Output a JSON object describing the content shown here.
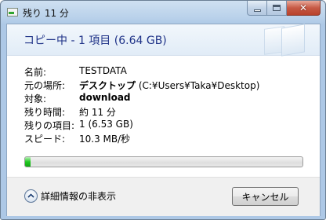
{
  "window": {
    "title": "残り 11 分"
  },
  "header": {
    "title": "コピー中 - 1 項目 (6.64 GB)"
  },
  "details": [
    {
      "label": "名前:",
      "value_bold": "",
      "value": "TESTDATA"
    },
    {
      "label": "元の場所:",
      "value_bold": "デスクトップ",
      "value": " (C:¥Users¥Taka¥Desktop)"
    },
    {
      "label": "対象:",
      "value_bold": "download",
      "value": ""
    },
    {
      "label": "残り時間:",
      "value_bold": "",
      "value": "約 11 分"
    },
    {
      "label": "残りの項目:",
      "value_bold": "",
      "value": "1 (6.53 GB)"
    },
    {
      "label": "スピード:",
      "value_bold": "",
      "value": "10.3 MB/秒"
    }
  ],
  "progress": {
    "fraction": 0.02
  },
  "footer": {
    "toggle_label": "詳細情報の非表示",
    "cancel_label": "キャンセル"
  },
  "colors": {
    "header_text": "#1e3287",
    "progress_fill": "#22c822"
  }
}
